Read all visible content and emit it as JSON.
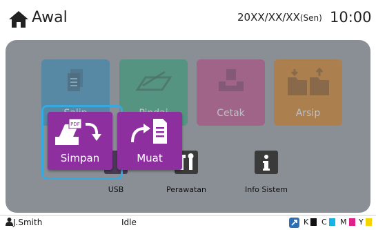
{
  "header": {
    "title": "Awal",
    "date": "20XX/XX/XX",
    "day": "(Sen)",
    "time": "10:00"
  },
  "tiles": [
    {
      "label": "Salin",
      "color": "#2f86b2"
    },
    {
      "label": "Pindai",
      "color": "#2c9a74"
    },
    {
      "label": "Cetak",
      "color": "#b3437f"
    },
    {
      "label": "Arsip",
      "color": "#c97416"
    }
  ],
  "utilities": {
    "usb": "USB",
    "maintenance": "Perawatan",
    "info": "Info Sistem"
  },
  "popup": {
    "save": "Simpan",
    "load": "Muat",
    "color": "#8e2fa0",
    "ring_color": "#35a9e0"
  },
  "status": {
    "user": "J.Smith",
    "state": "Idle",
    "ink": {
      "k": "K",
      "c": "C",
      "m": "M",
      "y": "Y"
    },
    "ink_colors": {
      "k": "#111111",
      "c": "#16b4e6",
      "m": "#e0218a",
      "y": "#f5d400"
    }
  }
}
